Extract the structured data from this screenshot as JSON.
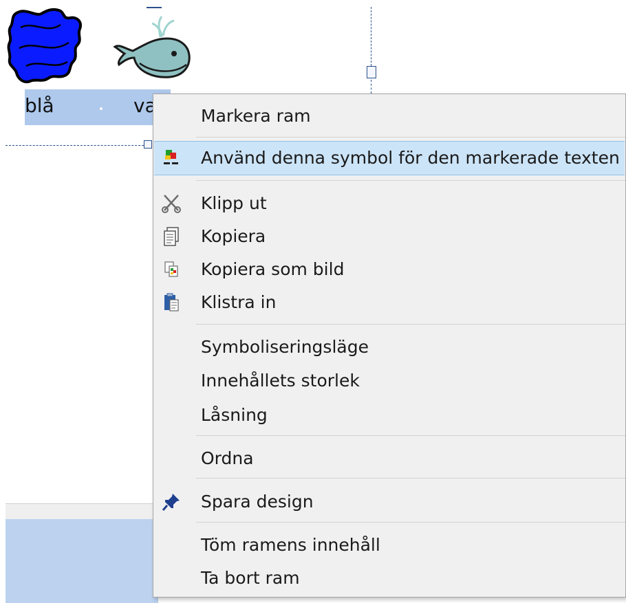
{
  "document": {
    "words": [
      "blå",
      "va"
    ]
  },
  "context_menu": {
    "items": [
      {
        "label": "Markera ram",
        "icon": ""
      },
      {
        "label": "Använd denna symbol för den markerade texten",
        "icon": "apply-symbol-icon",
        "highlighted": true
      },
      {
        "label": "Klipp ut",
        "icon": "scissors-icon"
      },
      {
        "label": "Kopiera",
        "icon": "copy-icon"
      },
      {
        "label": "Kopiera som bild",
        "icon": "copy-as-image-icon"
      },
      {
        "label": "Klistra in",
        "icon": "paste-icon"
      },
      {
        "label": "Symboliseringsläge",
        "icon": ""
      },
      {
        "label": "Innehållets storlek",
        "icon": ""
      },
      {
        "label": "Låsning",
        "icon": ""
      },
      {
        "label": "Ordna",
        "icon": ""
      },
      {
        "label": "Spara design",
        "icon": "pin-icon"
      },
      {
        "label": "Töm ramens innehåll",
        "icon": ""
      },
      {
        "label": "Ta bort ram",
        "icon": ""
      }
    ]
  },
  "colors": {
    "highlight": "#cce4f7",
    "menu_background": "#f0f0f0",
    "selection": "#aec9ec"
  }
}
